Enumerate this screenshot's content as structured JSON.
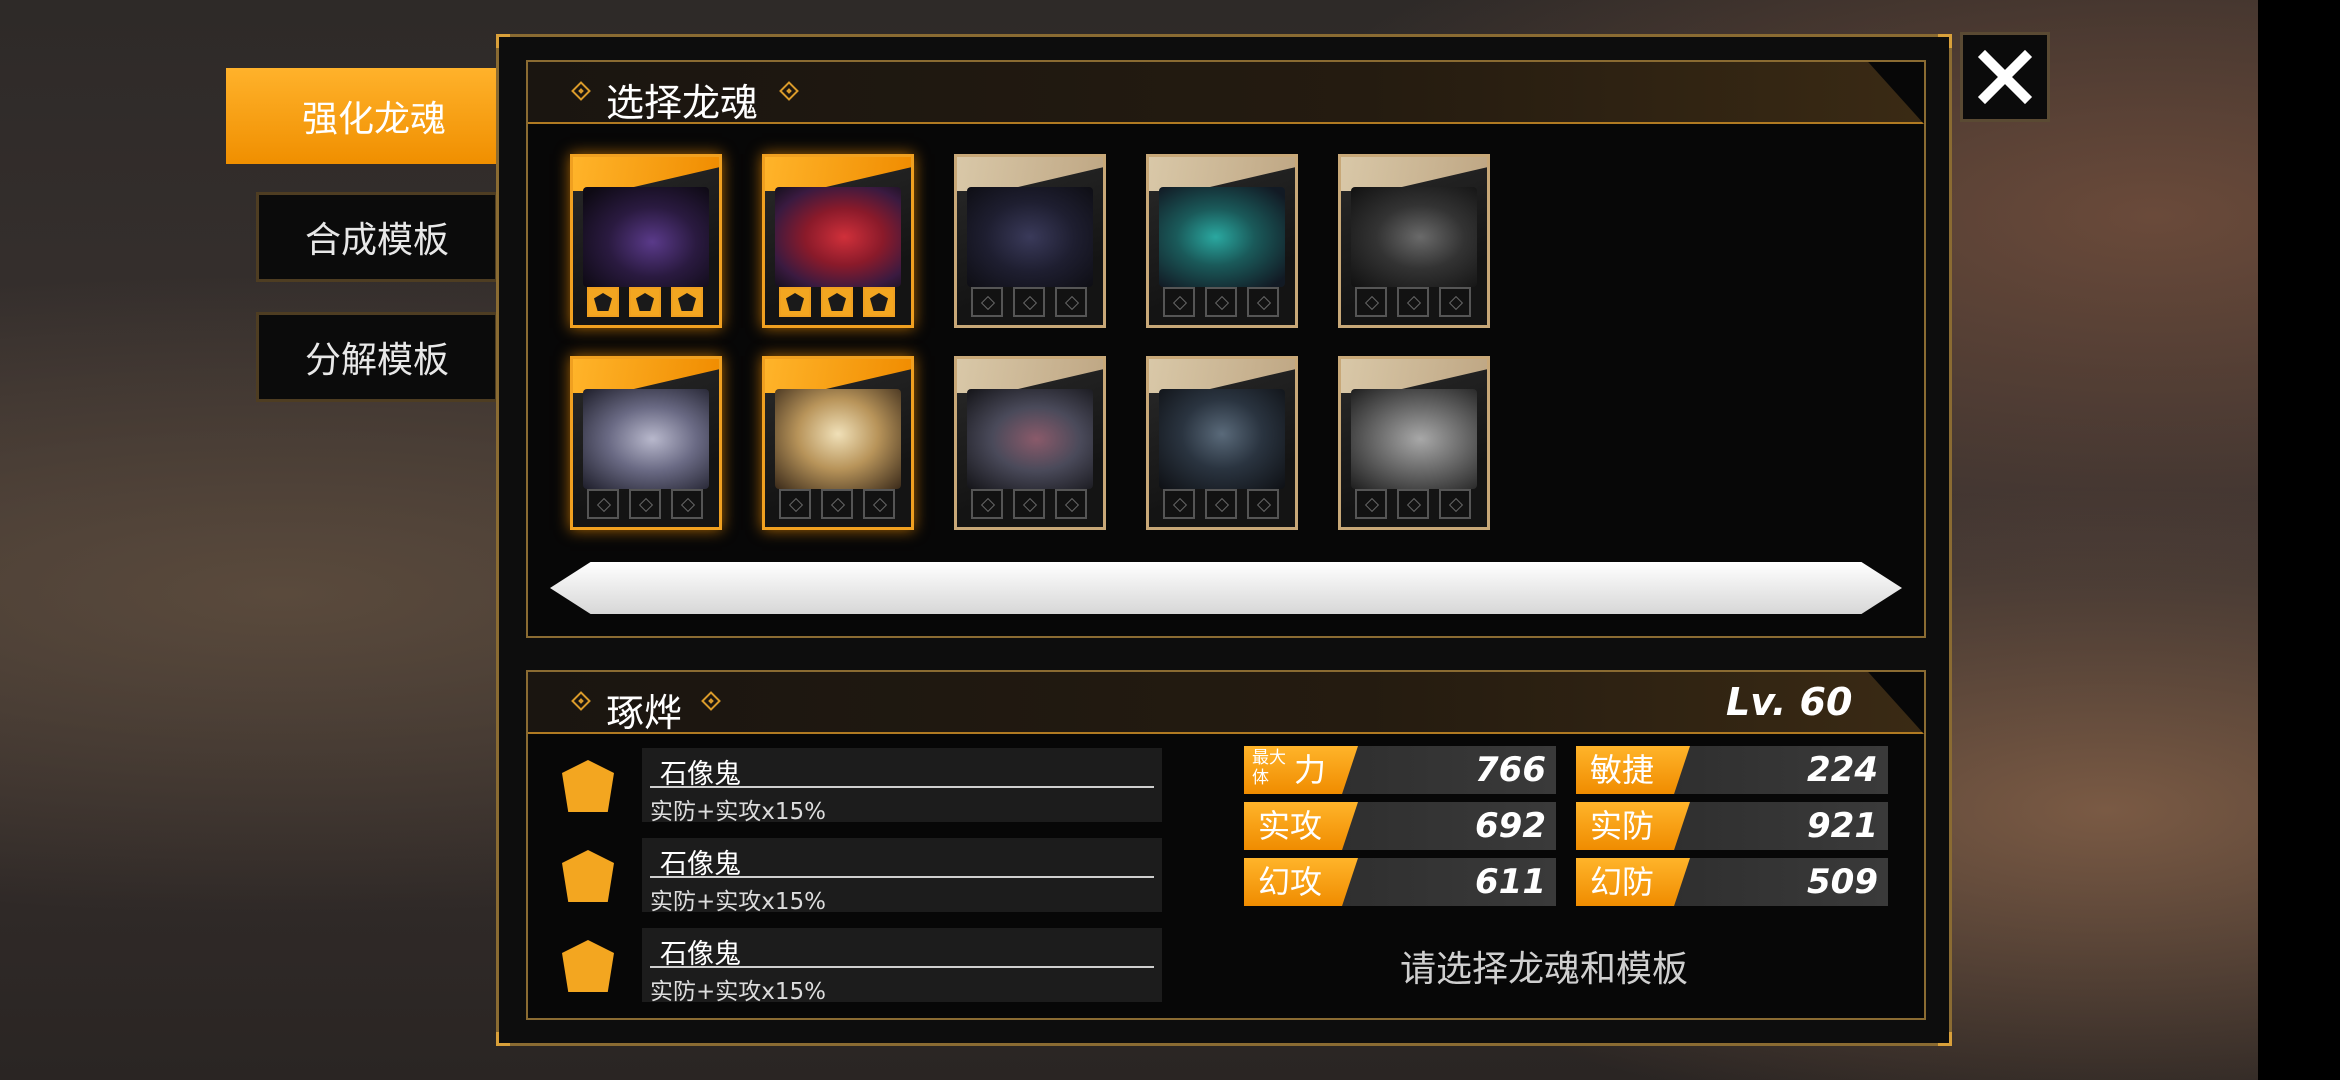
{
  "tabs": [
    {
      "label": "强化龙魂",
      "active": true
    },
    {
      "label": "合成模板",
      "active": false
    },
    {
      "label": "分解模板",
      "active": false
    }
  ],
  "select_section": {
    "title": "选择龙魂"
  },
  "cards": [
    {
      "name": "dragon-card-1",
      "rarity": "gold",
      "slots_filled": 3
    },
    {
      "name": "dragon-card-2",
      "rarity": "gold",
      "slots_filled": 3
    },
    {
      "name": "dragon-card-3",
      "rarity": "normal",
      "slots_filled": 0
    },
    {
      "name": "dragon-card-4",
      "rarity": "normal",
      "slots_filled": 0
    },
    {
      "name": "dragon-card-5",
      "rarity": "normal",
      "slots_filled": 0
    },
    {
      "name": "dragon-card-6",
      "rarity": "gold",
      "slots_filled": 0
    },
    {
      "name": "dragon-card-7",
      "rarity": "gold",
      "slots_filled": 0
    },
    {
      "name": "dragon-card-8",
      "rarity": "normal",
      "slots_filled": 0
    },
    {
      "name": "dragon-card-9",
      "rarity": "normal",
      "slots_filled": 0
    },
    {
      "name": "dragon-card-10",
      "rarity": "normal",
      "slots_filled": 0
    }
  ],
  "detail": {
    "name": "琢烨",
    "level": "Lv. 60",
    "templates": [
      {
        "name": "石像鬼",
        "desc": "实防+实攻x15%"
      },
      {
        "name": "石像鬼",
        "desc": "实防+实攻x15%"
      },
      {
        "name": "石像鬼",
        "desc": "实防+实攻x15%"
      }
    ],
    "stats": {
      "hp_small": "最大体",
      "hp_big": "力",
      "hp": "766",
      "agi_label": "敏捷",
      "agi": "224",
      "patk_label": "实攻",
      "patk": "692",
      "pdef_label": "实防",
      "pdef": "921",
      "matk_label": "幻攻",
      "matk": "611",
      "mdef_label": "幻防",
      "mdef": "509"
    },
    "hint": "请选择龙魂和模板"
  },
  "colors": {
    "accent": "#F39C12",
    "border": "#8A6B32"
  }
}
